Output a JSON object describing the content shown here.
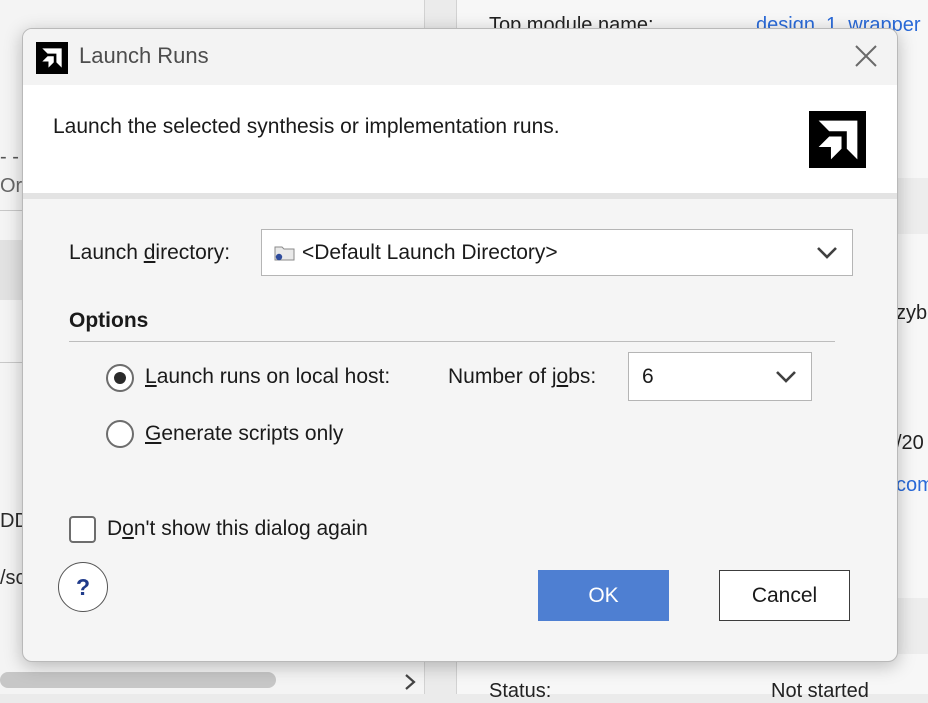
{
  "background": {
    "left_fragments": [
      "- -",
      "Ord",
      "DD",
      "/sc"
    ],
    "right_rows": {
      "top_label": "Top module name:",
      "top_value": "design_1_wrapper",
      "frag_zyb": "zyb",
      "frag_20": "/20",
      "frag_com": "com",
      "status_label": "Status:",
      "status_value": "Not started"
    }
  },
  "dialog": {
    "title": "Launch Runs",
    "description": "Launch the selected synthesis or implementation runs.",
    "launch_directory": {
      "label_pre": "Launch ",
      "label_mnemonic": "d",
      "label_post": "irectory:",
      "value": "<Default Launch Directory>"
    },
    "options": {
      "title": "Options",
      "local_host": {
        "mnemonic": "L",
        "label_rest": "aunch runs on local host:",
        "selected": true
      },
      "jobs": {
        "label_pre": "Number of j",
        "label_mnemonic": "o",
        "label_post": "bs:",
        "value": "6"
      },
      "scripts": {
        "mnemonic": "G",
        "label_rest": "enerate scripts only",
        "selected": false
      }
    },
    "dont_show": {
      "label_pre": "D",
      "label_mnemonic": "o",
      "label_post": "n't show this dialog again",
      "checked": false
    },
    "help_label": "?",
    "ok_label": "OK",
    "cancel_label": "Cancel"
  },
  "colors": {
    "accent": "#4e7fd2",
    "link": "#2a6ad8"
  }
}
